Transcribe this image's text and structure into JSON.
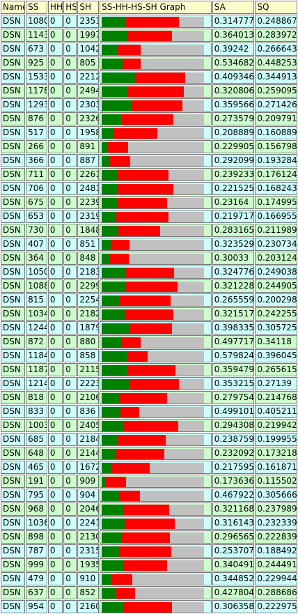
{
  "colors": {
    "header_bg": "#ffffcc",
    "row_even_bg": "#ccffff",
    "row_odd_bg": "#ccffcc",
    "graph_bg": "#c0c0c0",
    "ss_segment": "#008000",
    "sh_segment": "#ff0000"
  },
  "graph_max": 4560,
  "headers": [
    "Name",
    "SS",
    "HH",
    "HS",
    "SH",
    "SS-HH-HS-SH Graph",
    "SA",
    "SQ"
  ],
  "rows": [
    {
      "name": "DSN",
      "ss": "1080",
      "hh": "0",
      "hs": "0",
      "sh": "2351",
      "sa": "0.314777",
      "sq": "0.248867"
    },
    {
      "name": "DSN",
      "ss": "1143",
      "hh": "0",
      "hs": "0",
      "sh": "1997",
      "sa": "0.364013",
      "sq": "0.283972"
    },
    {
      "name": "DSN",
      "ss": "673",
      "hh": "0",
      "hs": "0",
      "sh": "1042",
      "sa": "0.39242",
      "sq": "0.266643"
    },
    {
      "name": "DSN",
      "ss": "925",
      "hh": "0",
      "hs": "0",
      "sh": "805",
      "sa": "0.534682",
      "sq": "0.448253"
    },
    {
      "name": "DSN",
      "ss": "1533",
      "hh": "0",
      "hs": "0",
      "sh": "2212",
      "sa": "0.409346",
      "sq": "0.344913"
    },
    {
      "name": "DSN",
      "ss": "1178",
      "hh": "0",
      "hs": "0",
      "sh": "2494",
      "sa": "0.320806",
      "sq": "0.259095"
    },
    {
      "name": "DSN",
      "ss": "1293",
      "hh": "0",
      "hs": "0",
      "sh": "2303",
      "sa": "0.359566",
      "sq": "0.271426"
    },
    {
      "name": "DSN",
      "ss": "876",
      "hh": "0",
      "hs": "0",
      "sh": "2326",
      "sa": "0.273579",
      "sq": "0.209791"
    },
    {
      "name": "DSN",
      "ss": "517",
      "hh": "0",
      "hs": "0",
      "sh": "1958",
      "sa": "0.208889",
      "sq": "0.160889"
    },
    {
      "name": "DSN",
      "ss": "266",
      "hh": "0",
      "hs": "0",
      "sh": "891",
      "sa": "0.229905",
      "sq": "0.156798"
    },
    {
      "name": "DSN",
      "ss": "366",
      "hh": "0",
      "hs": "0",
      "sh": "887",
      "sa": "0.292099",
      "sq": "0.193284"
    },
    {
      "name": "DSN",
      "ss": "711",
      "hh": "0",
      "hs": "0",
      "sh": "2261",
      "sa": "0.239233",
      "sq": "0.176124"
    },
    {
      "name": "DSN",
      "ss": "706",
      "hh": "0",
      "hs": "0",
      "sh": "2481",
      "sa": "0.221525",
      "sq": "0.168243"
    },
    {
      "name": "DSN",
      "ss": "675",
      "hh": "0",
      "hs": "0",
      "sh": "2239",
      "sa": "0.23164",
      "sq": "0.174995"
    },
    {
      "name": "DSN",
      "ss": "653",
      "hh": "0",
      "hs": "0",
      "sh": "2319",
      "sa": "0.219717",
      "sq": "0.166955"
    },
    {
      "name": "DSN",
      "ss": "730",
      "hh": "0",
      "hs": "0",
      "sh": "1848",
      "sa": "0.283165",
      "sq": "0.211989"
    },
    {
      "name": "DSN",
      "ss": "407",
      "hh": "0",
      "hs": "0",
      "sh": "851",
      "sa": "0.323529",
      "sq": "0.230734"
    },
    {
      "name": "DSN",
      "ss": "364",
      "hh": "0",
      "hs": "0",
      "sh": "848",
      "sa": "0.30033",
      "sq": "0.203124"
    },
    {
      "name": "DSN",
      "ss": "1050",
      "hh": "0",
      "hs": "0",
      "sh": "2183",
      "sa": "0.324776",
      "sq": "0.249038"
    },
    {
      "name": "DSN",
      "ss": "1088",
      "hh": "0",
      "hs": "0",
      "sh": "2299",
      "sa": "0.321228",
      "sq": "0.244905"
    },
    {
      "name": "DSN",
      "ss": "815",
      "hh": "0",
      "hs": "0",
      "sh": "2254",
      "sa": "0.265559",
      "sq": "0.200298"
    },
    {
      "name": "DSN",
      "ss": "1034",
      "hh": "0",
      "hs": "0",
      "sh": "2182",
      "sa": "0.321517",
      "sq": "0.242255"
    },
    {
      "name": "DSN",
      "ss": "1244",
      "hh": "0",
      "hs": "0",
      "sh": "1879",
      "sa": "0.398335",
      "sq": "0.305725"
    },
    {
      "name": "DSN",
      "ss": "872",
      "hh": "0",
      "hs": "0",
      "sh": "880",
      "sa": "0.497717",
      "sq": "0.34118"
    },
    {
      "name": "DSN",
      "ss": "1184",
      "hh": "0",
      "hs": "0",
      "sh": "858",
      "sa": "0.579824",
      "sq": "0.396045"
    },
    {
      "name": "DSN",
      "ss": "1187",
      "hh": "0",
      "hs": "0",
      "sh": "2115",
      "sa": "0.359479",
      "sq": "0.265615"
    },
    {
      "name": "DSN",
      "ss": "1214",
      "hh": "0",
      "hs": "0",
      "sh": "2223",
      "sa": "0.353215",
      "sq": "0.27139"
    },
    {
      "name": "DSN",
      "ss": "818",
      "hh": "0",
      "hs": "0",
      "sh": "2106",
      "sa": "0.279754",
      "sq": "0.214768"
    },
    {
      "name": "DSN",
      "ss": "833",
      "hh": "0",
      "hs": "0",
      "sh": "836",
      "sa": "0.499101",
      "sq": "0.405211"
    },
    {
      "name": "DSN",
      "ss": "1003",
      "hh": "0",
      "hs": "0",
      "sh": "2405",
      "sa": "0.294308",
      "sq": "0.219942"
    },
    {
      "name": "DSN",
      "ss": "685",
      "hh": "0",
      "hs": "0",
      "sh": "2184",
      "sa": "0.238759",
      "sq": "0.199955"
    },
    {
      "name": "DSN",
      "ss": "648",
      "hh": "0",
      "hs": "0",
      "sh": "2144",
      "sa": "0.232092",
      "sq": "0.173218"
    },
    {
      "name": "DSN",
      "ss": "465",
      "hh": "0",
      "hs": "0",
      "sh": "1672",
      "sa": "0.217595",
      "sq": "0.161871"
    },
    {
      "name": "DSN",
      "ss": "191",
      "hh": "0",
      "hs": "0",
      "sh": "909",
      "sa": "0.173636",
      "sq": "0.115502"
    },
    {
      "name": "DSN",
      "ss": "795",
      "hh": "0",
      "hs": "0",
      "sh": "904",
      "sa": "0.467922",
      "sq": "0.305666"
    },
    {
      "name": "DSN",
      "ss": "968",
      "hh": "0",
      "hs": "0",
      "sh": "2046",
      "sa": "0.321168",
      "sq": "0.237989"
    },
    {
      "name": "DSN",
      "ss": "1036",
      "hh": "0",
      "hs": "0",
      "sh": "2241",
      "sa": "0.316143",
      "sq": "0.232339"
    },
    {
      "name": "DSN",
      "ss": "898",
      "hh": "0",
      "hs": "0",
      "sh": "2130",
      "sa": "0.296565",
      "sq": "0.222839"
    },
    {
      "name": "DSN",
      "ss": "787",
      "hh": "0",
      "hs": "0",
      "sh": "2315",
      "sa": "0.253707",
      "sq": "0.188492"
    },
    {
      "name": "DSN",
      "ss": "999",
      "hh": "0",
      "hs": "0",
      "sh": "1935",
      "sa": "0.340491",
      "sq": "0.244491"
    },
    {
      "name": "DSN",
      "ss": "479",
      "hh": "0",
      "hs": "0",
      "sh": "910",
      "sa": "0.344852",
      "sq": "0.229944"
    },
    {
      "name": "DSN",
      "ss": "637",
      "hh": "0",
      "hs": "0",
      "sh": "852",
      "sa": "0.427804",
      "sq": "0.288686"
    },
    {
      "name": "DSN",
      "ss": "954",
      "hh": "0",
      "hs": "0",
      "sh": "2160",
      "sa": "0.306358",
      "sq": "0.222975"
    }
  ]
}
